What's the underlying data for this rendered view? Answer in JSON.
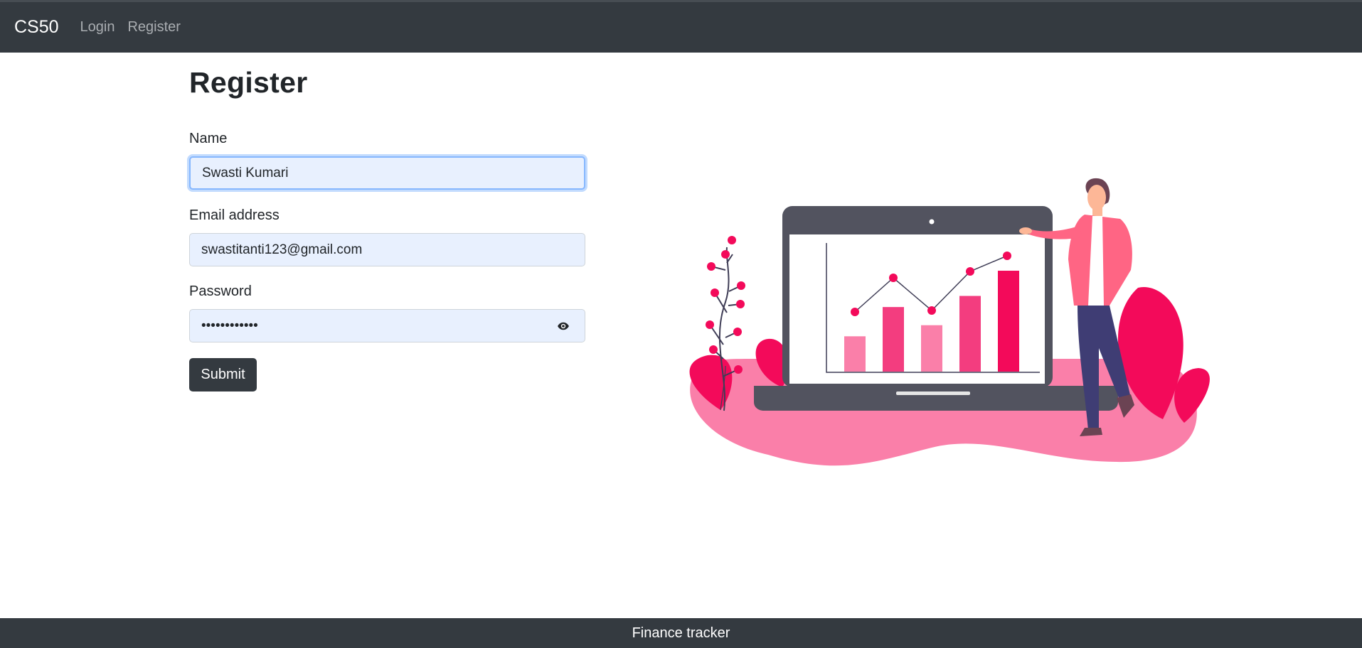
{
  "navbar": {
    "brand": "CS50",
    "links": [
      "Login",
      "Register"
    ]
  },
  "form": {
    "title": "Register",
    "name": {
      "label": "Name",
      "value": "Swasti Kumari"
    },
    "email": {
      "label": "Email address",
      "value": "swastitanti123@gmail.com"
    },
    "password": {
      "label": "Password",
      "value": "••••••••••••",
      "toggle_icon": "eye-icon"
    },
    "submit_label": "Submit"
  },
  "illustration": {
    "chart_bars": [
      0.35,
      0.64,
      0.46,
      0.75,
      1.0
    ],
    "colors": {
      "pink_light": "#fa7fa9",
      "pink": "#f33d7f",
      "pink_dark": "#f30a5a",
      "laptop": "#52535f"
    }
  },
  "footer": {
    "text": "Finance tracker"
  },
  "colors": {
    "navbar_bg": "#343a40",
    "input_bg": "#e8f0fe",
    "focus_border": "#86b7fe"
  }
}
